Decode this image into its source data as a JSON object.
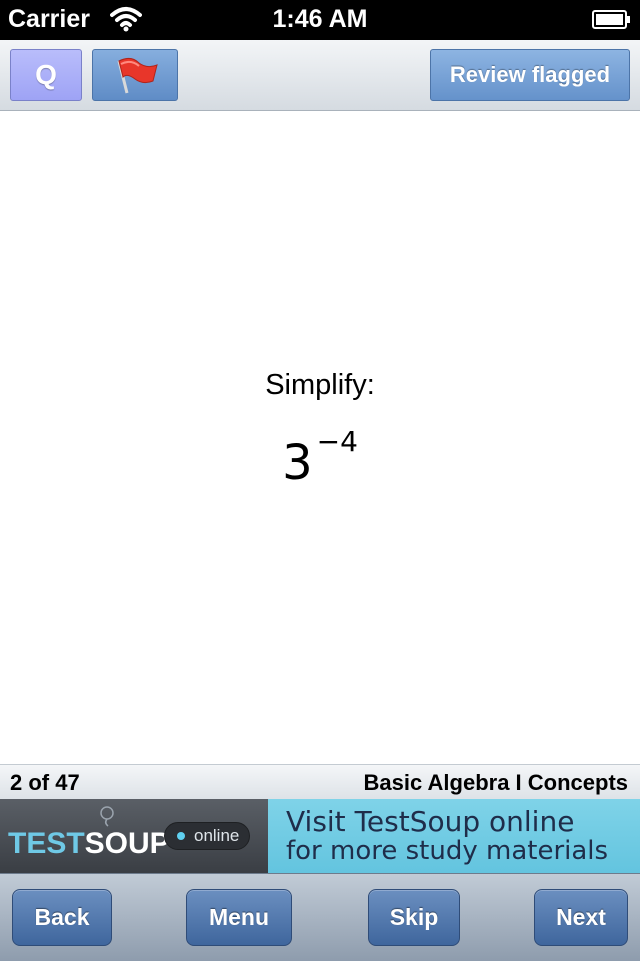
{
  "status_bar": {
    "carrier": "Carrier",
    "time": "1:46 AM"
  },
  "toolbar": {
    "q_label": "Q",
    "review_label": "Review flagged"
  },
  "question": {
    "prompt": "Simplify:",
    "base": "3",
    "exponent": "−4"
  },
  "info_bar": {
    "progress": "2 of 47",
    "category": "Basic Algebra I Concepts"
  },
  "ad": {
    "logo_part1": "TEST",
    "logo_part2": "SOUP",
    "status": "online",
    "line1": "Visit TestSoup online",
    "line2": "for more study materials"
  },
  "nav": {
    "back_label": "Back",
    "menu_label": "Menu",
    "skip_label": "Skip",
    "next_label": "Next"
  },
  "colors": {
    "q_button": "#a3a8f7",
    "flag_button": "#6a95cc",
    "flag": "#e8362a",
    "nav_button": "#4f75aa",
    "ad_accent": "#6fc9e6"
  },
  "icons": {
    "wifi": "wifi-icon",
    "battery": "battery-icon",
    "flag": "flag-icon"
  }
}
